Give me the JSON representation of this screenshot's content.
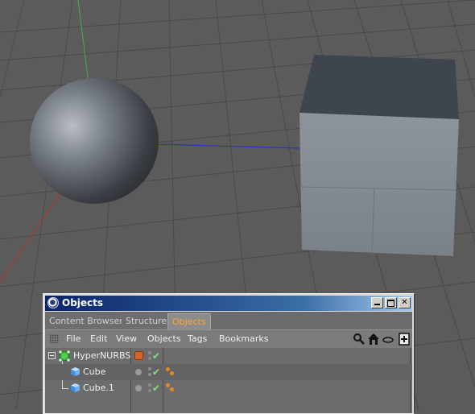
{
  "window": {
    "title": "Objects",
    "icon": "cinema4d-logo-icon"
  },
  "tabs": [
    {
      "label": "Content Browser",
      "active": false
    },
    {
      "label": "Structure",
      "active": false
    },
    {
      "label": "Objects",
      "active": true
    }
  ],
  "menu": {
    "items": [
      "File",
      "Edit",
      "View",
      "Objects",
      "Tags",
      "Bookmarks"
    ],
    "toolbar_icons": [
      "search-icon",
      "home-icon",
      "eye-icon",
      "new-object-icon"
    ]
  },
  "objects": [
    {
      "name": "HyperNURBS",
      "level": 0,
      "icon": "hypernurbs-icon",
      "enabled": true,
      "has_material": true
    },
    {
      "name": "Cube",
      "level": 1,
      "icon": "cube-icon",
      "enabled": true,
      "has_tags": true
    },
    {
      "name": "Cube.1",
      "level": 1,
      "icon": "cube-icon",
      "enabled": true,
      "has_tags": true
    }
  ],
  "colors": {
    "active_tab": "#ffa52a",
    "titlebar": "#0a246a",
    "enabled_check": "#7fe07f",
    "material": "#d6642a"
  }
}
